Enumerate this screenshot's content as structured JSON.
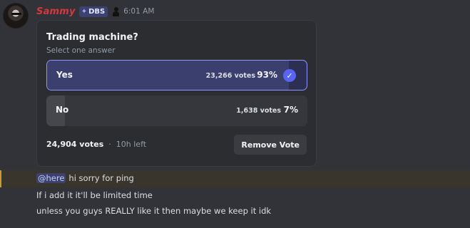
{
  "message": {
    "username": "Sammy",
    "tag_label": "DBS",
    "timestamp": "6:01 AM"
  },
  "poll": {
    "question": "Trading machine?",
    "subtitle": "Select one answer",
    "answers": [
      {
        "label": "Yes",
        "votes": "23,266 votes",
        "percent": "93%",
        "fraction": 0.93,
        "selected": true
      },
      {
        "label": "No",
        "votes": "1,638 votes",
        "percent": "7%",
        "fraction": 0.07,
        "selected": false
      }
    ],
    "total_votes": "24,904 votes",
    "separator": "·",
    "time_left": "10h left",
    "remove_label": "Remove Vote"
  },
  "followups": {
    "mention": "@here",
    "mention_text": "hi sorry for ping",
    "line1": "If i add it it'll be limited time",
    "line2": "unless you guys REALLY like it then maybe we keep it idk"
  },
  "colors": {
    "username": "#d9363e",
    "accent": "#5865f2",
    "mention_highlight": "#c99a2e"
  },
  "icons": {
    "tag": "guild-tag-icon",
    "check": "checkmark-icon"
  }
}
